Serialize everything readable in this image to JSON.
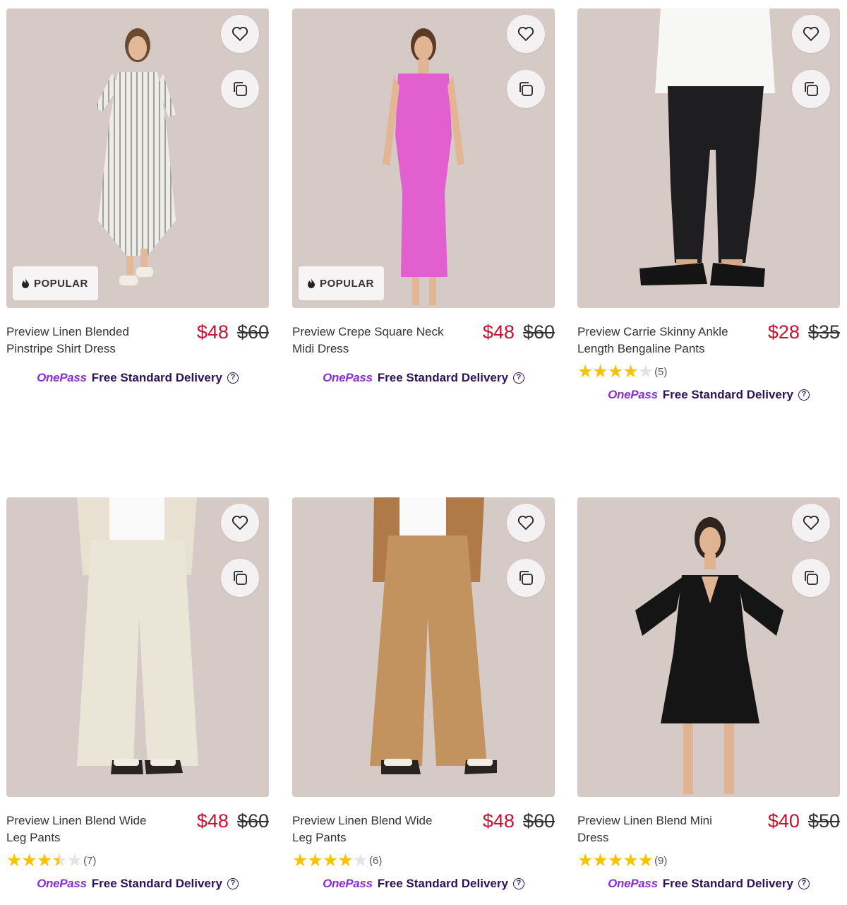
{
  "colors": {
    "sale_price": "#c8102e",
    "onepass": "#8a2ed6",
    "delivery_text": "#2a1457",
    "star": "#f5c400",
    "photo_bg": "#d6cac6"
  },
  "delivery": {
    "brand": "OnePass",
    "text": "Free Standard Delivery",
    "help_icon": "question-circle-icon"
  },
  "badge_label": "POPULAR",
  "products": [
    {
      "name": "Preview Linen Blended Pinstripe Shirt Dress",
      "price": "$48",
      "was_price": "$60",
      "popular": true,
      "rating": null,
      "review_count": null,
      "garment": "striped-shirt-dress"
    },
    {
      "name": "Preview Crepe Square Neck Midi Dress",
      "price": "$48",
      "was_price": "$60",
      "popular": true,
      "rating": null,
      "review_count": null,
      "garment": "pink-midi-dress"
    },
    {
      "name": "Preview Carrie Skinny Ankle Length Bengaline Pants",
      "price": "$28",
      "was_price": "$35",
      "popular": false,
      "rating": 4,
      "review_count": "(5)",
      "garment": "black-skinny-pants"
    },
    {
      "name": "Preview Linen Blend Wide Leg Pants",
      "price": "$48",
      "was_price": "$60",
      "popular": false,
      "rating": 3.5,
      "review_count": "(7)",
      "garment": "cream-wide-pants"
    },
    {
      "name": "Preview Linen Blend Wide Leg Pants",
      "price": "$48",
      "was_price": "$60",
      "popular": false,
      "rating": 4,
      "review_count": "(6)",
      "garment": "tan-wide-pants"
    },
    {
      "name": "Preview Linen Blend Mini Dress",
      "price": "$40",
      "was_price": "$50",
      "popular": false,
      "rating": 5,
      "review_count": "(9)",
      "garment": "black-mini-dress"
    }
  ]
}
